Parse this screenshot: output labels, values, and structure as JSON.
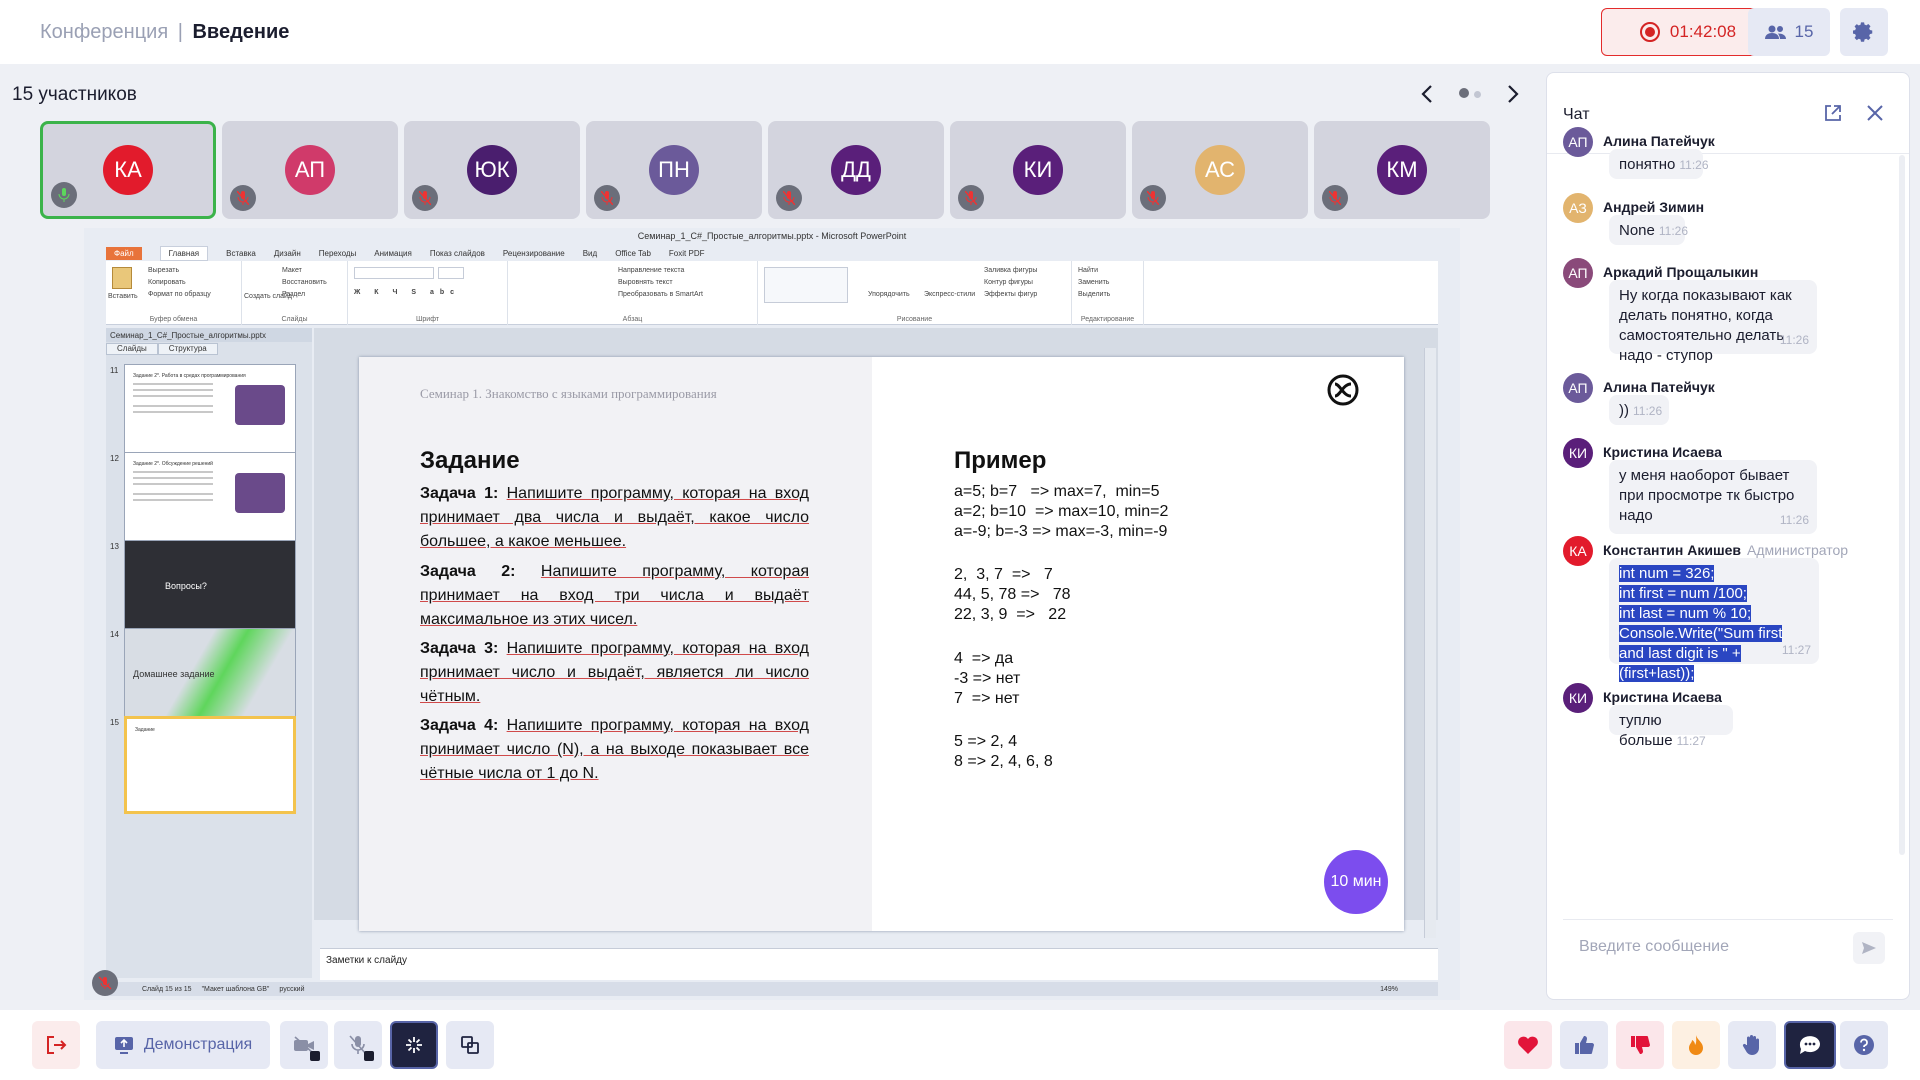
{
  "header": {
    "breadcrumb_parent": "Конференция",
    "breadcrumb_separator": "|",
    "breadcrumb_current": "Введение",
    "record_time": "01:42:08",
    "participants_count": "15"
  },
  "participants": {
    "title": "15 участников",
    "tiles": [
      {
        "initials": "КА",
        "color": "#e21b2c",
        "mic": "on"
      },
      {
        "initials": "АП",
        "color": "#d03a6a",
        "mic": "off"
      },
      {
        "initials": "ЮК",
        "color": "#4a1e6e",
        "mic": "off"
      },
      {
        "initials": "ПН",
        "color": "#6b5a9a",
        "mic": "off"
      },
      {
        "initials": "ДД",
        "color": "#5a1f7a",
        "mic": "off"
      },
      {
        "initials": "КИ",
        "color": "#5a1f7a",
        "mic": "off"
      },
      {
        "initials": "АС",
        "color": "#e2b46e",
        "mic": "off"
      },
      {
        "initials": "КМ",
        "color": "#5a1f7a",
        "mic": "off"
      }
    ]
  },
  "powerpoint": {
    "window_title": "Семинар_1_C#_Простые_алгоритмы.pptx - Microsoft PowerPoint",
    "tabs": [
      "Файл",
      "Главная",
      "Вставка",
      "Дизайн",
      "Переходы",
      "Анимация",
      "Показ слайдов",
      "Рецензирование",
      "Вид",
      "Office Tab",
      "Foxit PDF"
    ],
    "groups": {
      "clipboard": {
        "label": "Буфер обмена",
        "paste": "Вставить",
        "cut": "Вырезать",
        "copy": "Копировать",
        "format": "Формат по образцу"
      },
      "slides": {
        "label": "Слайды",
        "create": "Создать слайд",
        "layout": "Макет",
        "restore": "Восстановить",
        "section": "Раздел"
      },
      "font": {
        "label": "Шрифт"
      },
      "paragraph": {
        "label": "Абзац",
        "direction": "Направление текста",
        "align": "Выровнять текст",
        "smartart": "Преобразовать в SmartArt"
      },
      "drawing": {
        "label": "Рисование",
        "arrange": "Упорядочить",
        "styles": "Экспресс-стили",
        "fill": "Заливка фигуры",
        "outline": "Контур фигуры",
        "effects": "Эффекты фигур"
      },
      "editing": {
        "label": "Редактирование",
        "find": "Найти",
        "replace": "Заменить",
        "select": "Выделить"
      }
    },
    "doc_tab": "Семинар_1_C#_Простые_алгоритмы.pptx",
    "panel_tabs": [
      "Слайды",
      "Структура"
    ],
    "thumbs": [
      {
        "num": "11",
        "title": "Задание 2*. Работа в средах программирования"
      },
      {
        "num": "12",
        "title": "Задание 2*. Обсуждение решений"
      },
      {
        "num": "13",
        "title": "Вопросы?"
      },
      {
        "num": "14",
        "title": "Домашнее задание"
      },
      {
        "num": "15",
        "title": "Задание"
      }
    ],
    "notes": "Заметки к слайду",
    "status": {
      "slide": "Слайд 15 из 15",
      "theme": "\"Макет шаблона GB\"",
      "lang": "русский",
      "zoom": "149%"
    }
  },
  "slide": {
    "subtitle": "Семинар 1. Знакомство с языками программирования",
    "left_heading": "Задание",
    "right_heading": "Пример",
    "tasks": [
      {
        "label": "Задача 1:",
        "text": "Напишите программу, которая на вход принимает два числа и выдаёт, какое число большее, а какое меньшее."
      },
      {
        "label": "Задача 2:",
        "text": "Напишите программу, которая принимает на вход три числа и выдаёт максимальное из этих чисел."
      },
      {
        "label": "Задача 3:",
        "text": "Напишите программу, которая на вход принимает число и выдаёт, является ли число чётным."
      },
      {
        "label": "Задача 4:",
        "text": "Напишите программу, которая на вход принимает число (N), а на выходе показывает все чётные числа от 1 до N."
      }
    ],
    "examples": [
      "a=5; b=7   => max=7,  min=5\na=2; b=10  => max=10, min=2\na=-9; b=-3 => max=-3, min=-9",
      "2,  3, 7  =>   7\n44, 5, 78 =>   78\n22, 3, 9  =>   22",
      "4  => да\n-3 => нет\n7  => нет",
      "5 => 2, 4\n8 => 2, 4, 6, 8"
    ],
    "badge": "10 мин"
  },
  "chat": {
    "title": "Чат",
    "input_placeholder": "Введите сообщение",
    "messages": [
      {
        "initials": "АП",
        "color": "#6b5a9a",
        "name": "Алина Патейчук",
        "role": "",
        "text": "понятно",
        "time": "11:26"
      },
      {
        "initials": "АЗ",
        "color": "#e2b46e",
        "name": "Андрей Зимин",
        "role": "",
        "text": "None",
        "time": "11:26"
      },
      {
        "initials": "АП",
        "color": "#8a4a7a",
        "name": "Аркадий Прощалыкин",
        "role": "",
        "text": "Ну когда показывают как делать понятно, когда самостоятельно делать надо - ступор",
        "time": "11:26"
      },
      {
        "initials": "АП",
        "color": "#6b5a9a",
        "name": "Алина Патейчук",
        "role": "",
        "text": "))",
        "time": "11:26"
      },
      {
        "initials": "КИ",
        "color": "#5a1f7a",
        "name": "Кристина Исаева",
        "role": "",
        "text": "у меня наоборот бывает при просмотре тк быстро надо",
        "time": "11:26"
      },
      {
        "initials": "КА",
        "color": "#e21b2c",
        "name": "Константин Акишев",
        "role": "Администратор",
        "code": [
          "int num = 326;",
          "int first = num /100;",
          "int last = num % 10;",
          "Console.Write(\"Sum first",
          "and last digit is \" +",
          "(first+last));"
        ],
        "time": "11:27"
      },
      {
        "initials": "КИ",
        "color": "#5a1f7a",
        "name": "Кристина Исаева",
        "role": "",
        "text": "туплю больше",
        "time": "11:27"
      }
    ]
  },
  "toolbar": {
    "demo_label": "Демонстрация"
  },
  "colors": {
    "accent": "#5865a8",
    "record": "#d42424",
    "active_border": "#3bb34a",
    "badge": "#7c4dee"
  }
}
